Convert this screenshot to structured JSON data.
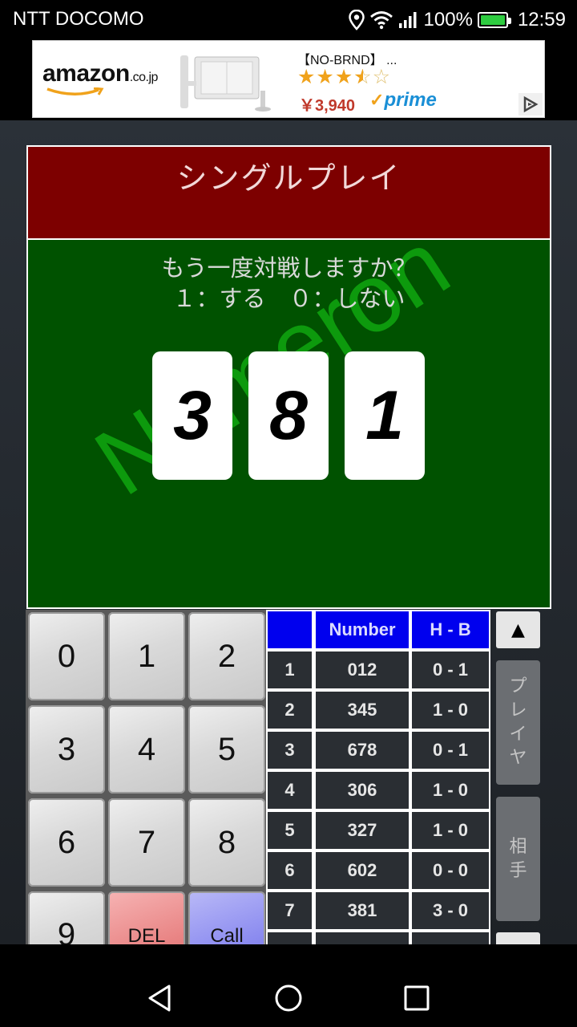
{
  "status_bar": {
    "carrier": "NTT DOCOMO",
    "battery": "100%",
    "time": "12:59",
    "icons": [
      "location-icon",
      "wifi-icon",
      "signal-icon",
      "battery-icon"
    ]
  },
  "ad": {
    "logo_main": "amazon",
    "logo_suffix": ".co.jp",
    "title": "【NO-BRND】 ...",
    "rating_stars": 3.5,
    "price": "￥3,940",
    "prime": "prime",
    "colors": {
      "price": "#c0392b",
      "prime": "#1a8fd6",
      "stars": "#f0a21b"
    }
  },
  "game": {
    "mode_title": "シングルプレイ",
    "prompt_line1": "もう一度対戦しますか？",
    "prompt_line2": "１：する　０：しない",
    "watermark": "Numeron",
    "cards": [
      "3",
      "8",
      "1"
    ],
    "colors": {
      "title_bg": "#7d0000",
      "board_bg": "#005200",
      "watermark": "#0d9a0d"
    }
  },
  "keypad": {
    "keys": [
      "0",
      "1",
      "2",
      "3",
      "4",
      "5",
      "6",
      "7",
      "8",
      "9",
      "DEL",
      "Call"
    ]
  },
  "history": {
    "headers": [
      "",
      "Number",
      "H - B"
    ],
    "rows": [
      {
        "no": "1",
        "number": "012",
        "hb": "0 - 1"
      },
      {
        "no": "2",
        "number": "345",
        "hb": "1 - 0"
      },
      {
        "no": "3",
        "number": "678",
        "hb": "0 - 1"
      },
      {
        "no": "4",
        "number": "306",
        "hb": "1 - 0"
      },
      {
        "no": "5",
        "number": "327",
        "hb": "1 - 0"
      },
      {
        "no": "6",
        "number": "602",
        "hb": "0 - 0"
      },
      {
        "no": "7",
        "number": "381",
        "hb": "3 - 0"
      }
    ]
  },
  "side": {
    "scroll_up": "▲",
    "player_tab": [
      "プ",
      "レ",
      "イ",
      "ヤ"
    ],
    "opponent_tab": [
      "相",
      "手"
    ]
  }
}
